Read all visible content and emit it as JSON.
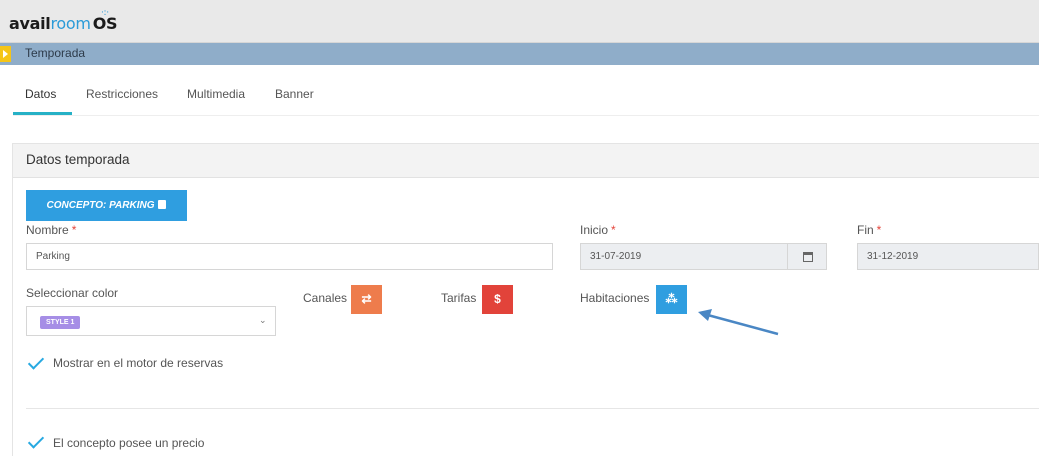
{
  "app": {
    "logo_avail": "avail",
    "logo_room": "room",
    "logo_os": "OS",
    "logo_dots": "·:·"
  },
  "breadcrumb": {
    "title": "Temporada"
  },
  "tabs": [
    {
      "label": "Datos",
      "active": true
    },
    {
      "label": "Restricciones",
      "active": false
    },
    {
      "label": "Multimedia",
      "active": false
    },
    {
      "label": "Banner",
      "active": false
    }
  ],
  "panel": {
    "title": "Datos temporada",
    "concept_button": "CONCEPTO: PARKING",
    "nombre": {
      "label": "Nombre",
      "required_mark": "*",
      "value": "Parking"
    },
    "inicio": {
      "label": "Inicio",
      "required_mark": "*",
      "value": "31-07-2019"
    },
    "fin": {
      "label": "Fin",
      "required_mark": "*",
      "value": "31-12-2019"
    },
    "color": {
      "label": "Seleccionar color",
      "selected": "STYLE 1",
      "chip_color": "#a68ee6"
    },
    "canales": {
      "label": "Canales",
      "icon": "⇄"
    },
    "tarifas": {
      "label": "Tarifas",
      "icon": "$"
    },
    "habitaciones": {
      "label": "Habitaciones",
      "icon": "⁂"
    },
    "mostrar_motor": {
      "label": "Mostrar en el motor de reservas",
      "checked": true
    },
    "posee_precio": {
      "label": "El concepto posee un precio",
      "checked": true
    }
  },
  "colors": {
    "accent_blue": "#2f9ee0",
    "orange": "#ee7c4c",
    "red": "#e2433a",
    "tab_underline": "#26b1c6",
    "subbar": "#8fadc9"
  }
}
